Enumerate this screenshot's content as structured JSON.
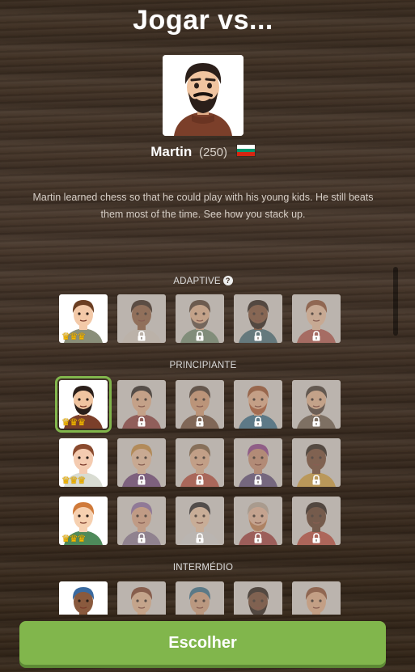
{
  "page": {
    "title": "Jogar vs..."
  },
  "selected_bot": {
    "name": "Martin",
    "rating": "(250)",
    "flag_colors": [
      "#ffffff",
      "#00966e",
      "#d62612"
    ],
    "bio": "Martin learned chess so that he could play with his young kids. He still beats them most of the time. See how you stack up."
  },
  "sections": [
    {
      "label": "ADAPTIVE",
      "help_icon": "?",
      "bots": [
        {
          "skin": "#f3c9a8",
          "hair": "#6b3e22",
          "shirt": "#8a8f7a",
          "beard": "",
          "locked": false,
          "crowns": "♛♛♛"
        },
        {
          "skin": "#8d5a3b",
          "hair": "#2a1a12",
          "shirt": "#d9d2c8",
          "beard": "",
          "locked": true,
          "crowns": ""
        },
        {
          "skin": "#e8b48f",
          "hair": "#4a3426",
          "shirt": "#6f8f74",
          "beard": "#5a4a3e",
          "locked": true,
          "crowns": ""
        },
        {
          "skin": "#7a4a2e",
          "hair": "#1c120c",
          "shirt": "#3d6b78",
          "beard": "#1c120c",
          "locked": true,
          "crowns": ""
        },
        {
          "skin": "#efc2a0",
          "hair": "#8a4a2a",
          "shirt": "#b2534a",
          "beard": "",
          "locked": true,
          "crowns": ""
        }
      ]
    },
    {
      "label": "PRINCIPIANTE",
      "help_icon": "",
      "bots": [
        {
          "skin": "#f0c4a0",
          "hair": "#2b1f1a",
          "shirt": "#7b3f2a",
          "beard": "#2b1f1a",
          "locked": false,
          "crowns": "♛♛♛",
          "selected": true
        },
        {
          "skin": "#e9b38c",
          "hair": "#1f1a18",
          "shirt": "#8a3a3a",
          "beard": "",
          "locked": true,
          "crowns": ""
        },
        {
          "skin": "#d99b72",
          "hair": "#3b2a20",
          "shirt": "#6d4a33",
          "beard": "",
          "locked": true,
          "crowns": ""
        },
        {
          "skin": "#eab089",
          "hair": "#9a4a22",
          "shirt": "#2f6b8a",
          "beard": "#b0552a",
          "locked": true,
          "crowns": ""
        },
        {
          "skin": "#e7b58f",
          "hair": "#3a3028",
          "shirt": "#6a5a4a",
          "beard": "#4a3a30",
          "locked": true,
          "crowns": ""
        }
      ]
    },
    {
      "label": "",
      "help_icon": "",
      "bots": [
        {
          "skin": "#f4cbb0",
          "hair": "#8a4a2e",
          "shirt": "#d9dcd2",
          "beard": "",
          "locked": false,
          "crowns": "♛♛♛"
        },
        {
          "skin": "#f0c29e",
          "hair": "#c98a3a",
          "shirt": "#6a3f7a",
          "beard": "",
          "locked": true,
          "crowns": ""
        },
        {
          "skin": "#e6b08a",
          "hair": "#7a5a3a",
          "shirt": "#b84a3a",
          "beard": "",
          "locked": true,
          "crowns": ""
        },
        {
          "skin": "#c98a6e",
          "hair": "#8a3a8a",
          "shirt": "#5a4a7a",
          "beard": "",
          "locked": true,
          "crowns": ""
        },
        {
          "skin": "#6e4028",
          "hair": "#1e140e",
          "shirt": "#d8a23a",
          "beard": "",
          "locked": true,
          "crowns": ""
        }
      ]
    },
    {
      "label": "",
      "help_icon": "",
      "bots": [
        {
          "skin": "#f6d0b0",
          "hair": "#d07a3a",
          "shirt": "#4e8a5a",
          "beard": "",
          "locked": false,
          "crowns": "♛♛♛"
        },
        {
          "skin": "#e2a887",
          "hair": "#8a6aa8",
          "shirt": "#8a7a9a",
          "beard": "",
          "locked": true,
          "crowns": ""
        },
        {
          "skin": "#f0c8a8",
          "hair": "#1a1a1e",
          "shirt": "#d8d8d8",
          "beard": "",
          "locked": true,
          "crowns": ""
        },
        {
          "skin": "#eab699",
          "hair": "#b8a898",
          "shirt": "#a03a3a",
          "beard": "#c07a4a",
          "locked": true,
          "crowns": ""
        },
        {
          "skin": "#5a3420",
          "hair": "#1a100a",
          "shirt": "#c0473a",
          "beard": "",
          "locked": true,
          "crowns": ""
        }
      ]
    },
    {
      "label": "INTERMÉDIO",
      "help_icon": "",
      "bots": [
        {
          "skin": "#8a5a3e",
          "hair": "#3a6aa0",
          "shirt": "#3a5a8a",
          "beard": "",
          "locked": false,
          "crowns": ""
        },
        {
          "skin": "#e9b892",
          "hair": "#7a3a22",
          "shirt": "#6a5a4a",
          "beard": "",
          "locked": true,
          "crowns": ""
        },
        {
          "skin": "#d8a27e",
          "hair": "#2a6a8a",
          "shirt": "#5a6a7a",
          "beard": "",
          "locked": true,
          "crowns": ""
        },
        {
          "skin": "#6e4028",
          "hair": "#1a120c",
          "shirt": "#b04a3a",
          "beard": "#1a120c",
          "locked": true,
          "crowns": ""
        },
        {
          "skin": "#e8b088",
          "hair": "#8a4a2a",
          "shirt": "#7a5a3a",
          "beard": "",
          "locked": true,
          "crowns": ""
        }
      ]
    }
  ],
  "footer": {
    "choose_label": "Escolher"
  },
  "colors": {
    "accent": "#81b64c",
    "accent_shadow": "#5d8a35"
  }
}
